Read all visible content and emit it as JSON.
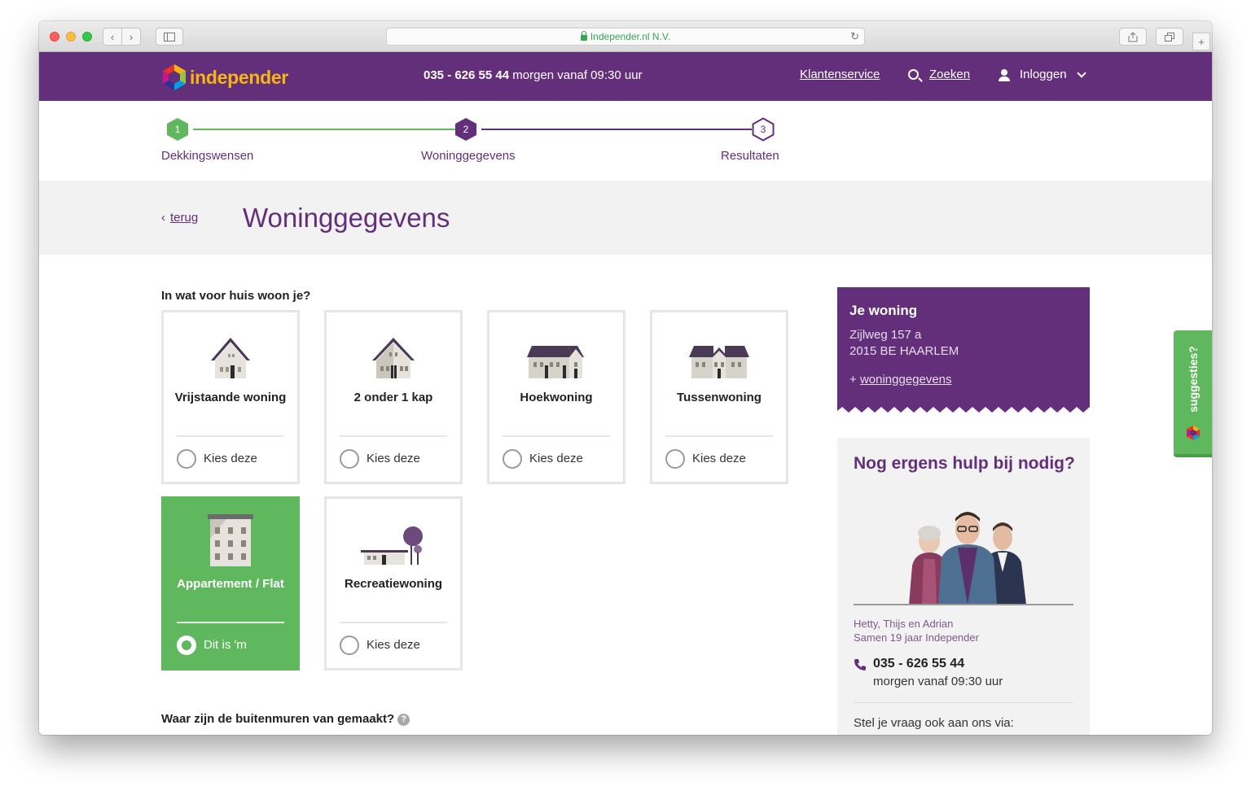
{
  "browser": {
    "url": "Independer.nl N.V."
  },
  "header": {
    "logo_text": "independer",
    "phone": "035 - 626 55 44",
    "phone_hours": "morgen vanaf 09:30 uur",
    "nav": {
      "klantenservice": "Klantenservice",
      "zoeken": "Zoeken",
      "inloggen": "Inloggen"
    }
  },
  "stepper": {
    "steps": [
      {
        "number": "1",
        "label": "Dekkingswensen",
        "state": "done"
      },
      {
        "number": "2",
        "label": "Woninggegevens",
        "state": "current"
      },
      {
        "number": "3",
        "label": "Resultaten",
        "state": "upcoming"
      }
    ]
  },
  "titlebar": {
    "back_label": "terug",
    "title": "Woninggegevens"
  },
  "question1": {
    "label": "In wat voor huis woon je?",
    "options": [
      {
        "label": "Vrijstaande woning",
        "radio_label": "Kies deze",
        "selected": false
      },
      {
        "label": "2 onder 1 kap",
        "radio_label": "Kies deze",
        "selected": false
      },
      {
        "label": "Hoekwoning",
        "radio_label": "Kies deze",
        "selected": false
      },
      {
        "label": "Tussenwoning",
        "radio_label": "Kies deze",
        "selected": false
      },
      {
        "label": "Appartement / Flat",
        "radio_label": "Dit is 'm",
        "selected": true
      },
      {
        "label": "Recreatiewoning",
        "radio_label": "Kies deze",
        "selected": false
      }
    ]
  },
  "question2": {
    "label": "Waar zijn de buitenmuren van gemaakt?",
    "help": "?"
  },
  "sidebar": {
    "woning": {
      "title": "Je woning",
      "address_line1": "Zijlweg 157 a",
      "address_line2": "2015 BE HAARLEM",
      "link_prefix": "+",
      "link": "woninggegevens"
    },
    "help": {
      "title": "Nog ergens hulp bij nodig?",
      "names": "Hetty, Thijs en Adrian",
      "subtitle": "Samen 19 jaar Independer",
      "phone": "035 - 626 55 44",
      "hours": "morgen vanaf 09:30 uur",
      "ask": "Stel je vraag ook aan ons via:"
    }
  },
  "feedback_tab": {
    "label": "suggesties?"
  },
  "colors": {
    "brand_purple": "#642f7a",
    "accent_green": "#5fb85e",
    "logo_yellow": "#f6b513"
  }
}
